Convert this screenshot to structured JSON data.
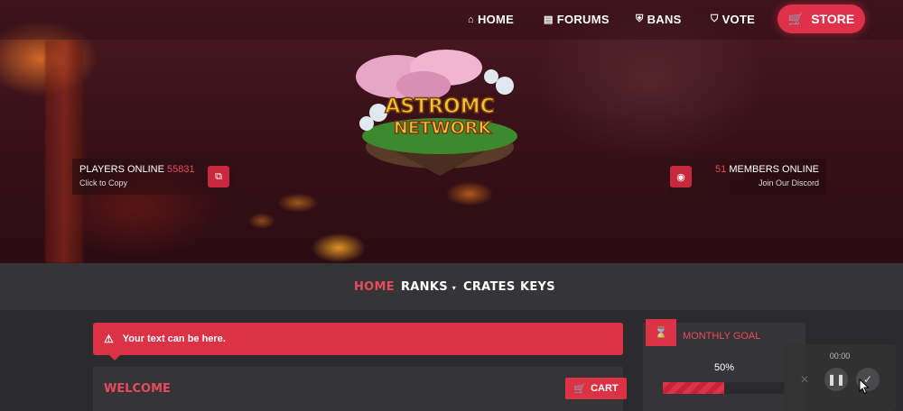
{
  "nav": {
    "home": "HOME",
    "forums": "FORUMS",
    "bans": "BANS",
    "vote": "VOTE",
    "store": "STORE"
  },
  "logo": {
    "alt": "ASTROMC NETWORK"
  },
  "players": {
    "label": "PLAYERS ONLINE",
    "count": "55831",
    "sub": "Click to Copy"
  },
  "discord": {
    "count": "51",
    "label": "MEMBERS ONLINE",
    "sub": "Join Our Discord"
  },
  "subnav": {
    "home": "HOME",
    "ranks": "RANKS",
    "crates": "CRATES",
    "keys": "KEYS"
  },
  "alert": {
    "text": "Your text can be here."
  },
  "welcome": {
    "title": "WELCOME",
    "cart": "CART"
  },
  "goal": {
    "label": "MONTHLY GOAL",
    "percent_text": "50%",
    "progress": 0.5
  },
  "player": {
    "time": "00:00"
  },
  "colors": {
    "accent": "#e0314a",
    "panel": "#353537",
    "background": "#2b2b2d"
  }
}
